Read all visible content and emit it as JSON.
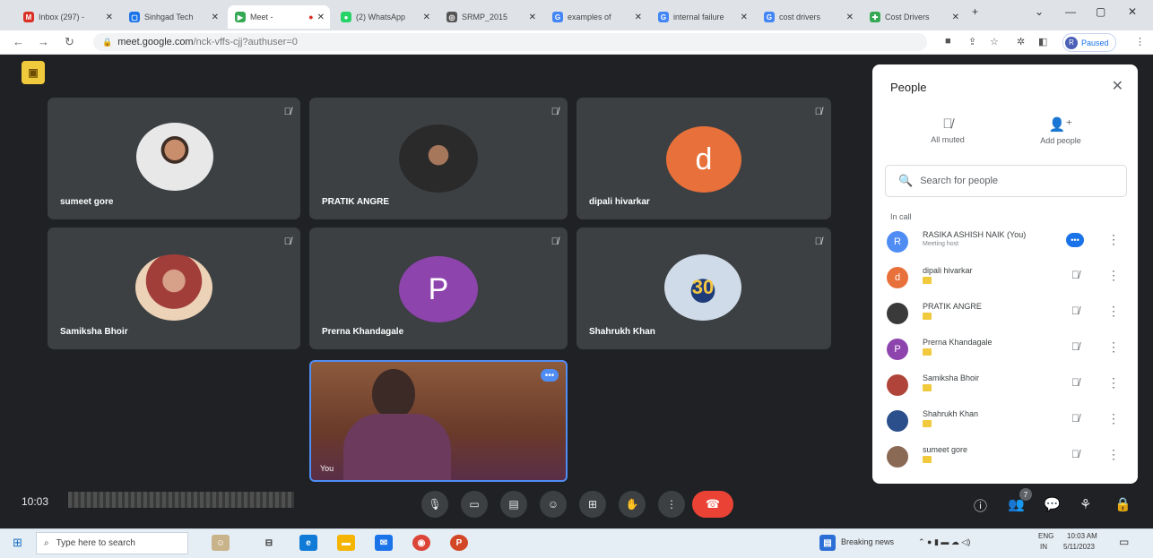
{
  "browser": {
    "tabs": [
      {
        "label": "Inbox (297) -",
        "favicon_color": "#d93025",
        "favicon_glyph": "M",
        "active": false
      },
      {
        "label": "Sinhgad Tech",
        "favicon_color": "#1a73e8",
        "favicon_glyph": "▢",
        "active": false
      },
      {
        "label": "Meet - ",
        "favicon_color": "#34a853",
        "favicon_glyph": "▶",
        "active": true
      },
      {
        "label": "(2) WhatsApp",
        "favicon_color": "#25d366",
        "favicon_glyph": "●",
        "active": false
      },
      {
        "label": "SRMP_2015",
        "favicon_color": "#555555",
        "favicon_glyph": "◎",
        "active": false
      },
      {
        "label": "examples of",
        "favicon_color": "#4285f4",
        "favicon_glyph": "G",
        "active": false
      },
      {
        "label": "internal failure",
        "favicon_color": "#4285f4",
        "favicon_glyph": "G",
        "active": false
      },
      {
        "label": "cost drivers",
        "favicon_color": "#4285f4",
        "favicon_glyph": "G",
        "active": false
      },
      {
        "label": "Cost Drivers",
        "favicon_color": "#34a853",
        "favicon_glyph": "✚",
        "active": false
      }
    ],
    "new_tab": "+",
    "url_host": "meet.google.com",
    "url_path": "/nck-vffs-cjj?authuser=0",
    "profile_initial": "R",
    "profile_label": "Paused"
  },
  "meet": {
    "tiles": [
      {
        "name": "sumeet gore",
        "avatar_type": "photo1",
        "letter": ""
      },
      {
        "name": "PRATIK ANGRE",
        "avatar_type": "photo2",
        "letter": ""
      },
      {
        "name": "dipali hivarkar",
        "avatar_type": "letter",
        "letter": "d",
        "color": "#e8703a"
      },
      {
        "name": "Samiksha Bhoir",
        "avatar_type": "photo3",
        "letter": ""
      },
      {
        "name": "Prerna Khandagale",
        "avatar_type": "letter",
        "letter": "P",
        "color": "#8e44ad"
      },
      {
        "name": "Shahrukh Khan",
        "avatar_type": "photo4",
        "letter": "30"
      }
    ],
    "self_tile": {
      "name": "You",
      "more": "•••"
    },
    "clock": "10:03",
    "participant_count": "7"
  },
  "people_panel": {
    "title": "People",
    "all_muted": "All muted",
    "add_people": "Add people",
    "search_placeholder": "Search for people",
    "section": "In call",
    "participants": [
      {
        "name": "RASIKA ASHISH NAIK (You)",
        "sub": "Meeting host",
        "initial": "R",
        "color": "#4f8df5",
        "you": true
      },
      {
        "name": "dipali hivarkar",
        "sub": "",
        "initial": "d",
        "color": "#e8703a",
        "you": false
      },
      {
        "name": "PRATIK ANGRE",
        "sub": "",
        "initial": "",
        "color": "#3a3a3a",
        "you": false
      },
      {
        "name": "Prerna Khandagale",
        "sub": "",
        "initial": "P",
        "color": "#8e44ad",
        "you": false
      },
      {
        "name": "Samiksha Bhoir",
        "sub": "",
        "initial": "",
        "color": "#b0443a",
        "you": false
      },
      {
        "name": "Shahrukh Khan",
        "sub": "",
        "initial": "",
        "color": "#2b4f8a",
        "you": false
      },
      {
        "name": "sumeet gore",
        "sub": "",
        "initial": "",
        "color": "#8a6a55",
        "you": false
      }
    ]
  },
  "taskbar": {
    "search_placeholder": "Type here to search",
    "news": "Breaking news",
    "lang": "ENG",
    "region": "IN",
    "time": "10:03 AM",
    "date": "5/11/2023"
  }
}
